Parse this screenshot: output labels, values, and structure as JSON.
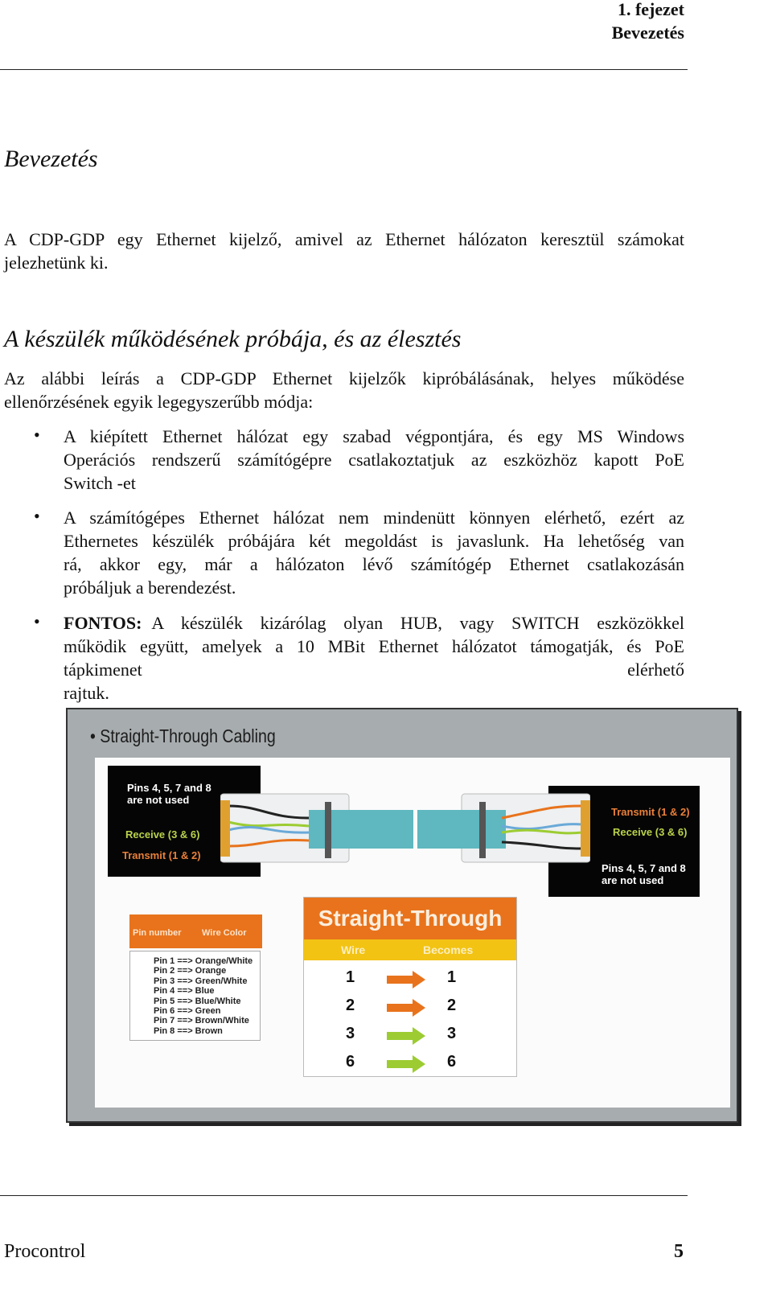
{
  "header": {
    "chapter": "1. fejezet",
    "title": "Bevezetés"
  },
  "section1": {
    "heading": "Bevezetés",
    "lines": [
      "A CDP-GDP egy Ethernet kijelző, amivel az Ethernet hálózaton keresztül számokat",
      "jelezhetünk ki."
    ]
  },
  "section2": {
    "heading": "A készülék működésének próbája, és az élesztés",
    "intro": [
      "Az alábbi leírás a CDP-GDP Ethernet kijelzők kipróbálásának, helyes működése",
      "ellenőrzésének egyik legegyszerűbb módja:"
    ],
    "bullets": [
      {
        "lines": [
          "A kiépített Ethernet hálózat egy szabad végpontjára, és egy MS Windows",
          "Operációs rendszerű számítógépre csatlakoztatjuk az eszközhöz kapott PoE",
          "Switch -et"
        ]
      },
      {
        "lines": [
          "A számítógépes Ethernet hálózat nem mindenütt könnyen elérhető, ezért az",
          "Ethernetes készülék próbájára két megoldást is javaslunk. Ha lehetőség van",
          "rá, akkor egy, már a hálózaton lévő számítógép Ethernet csatlakozásán",
          "próbáljuk a berendezést."
        ]
      },
      {
        "bold": "FONTOS:",
        "lines": [
          " A készülék kizárólag olyan HUB, vagy SWITCH eszközökkel",
          "működik együtt, amelyek a 10 MBit Ethernet hálózatot támogatják, és PoE",
          "tápkimenet elérhető",
          "rajtuk."
        ]
      }
    ]
  },
  "figure": {
    "title": "• Straight-Through Cabling",
    "left_box": {
      "note": [
        "Pins 4, 5, 7 and 8",
        "are not used"
      ],
      "receive": "Receive (3 & 6)",
      "transmit": "Transmit (1 & 2)"
    },
    "right_box": {
      "transmit": "Transmit (1 & 2)",
      "receive": "Receive (3 & 6)",
      "note": [
        "Pins 4, 5, 7 and 8",
        "are not used"
      ]
    },
    "pin_table": {
      "headers": [
        "Pin number",
        "Wire Color"
      ],
      "rows": [
        "Pin 1 ==> Orange/White",
        "Pin 2 ==> Orange",
        "Pin 3 ==> Green/White",
        "Pin 4 ==> Blue",
        "Pin 5 ==> Blue/White",
        "Pin 6 ==> Green",
        "Pin 7 ==> Brown/White",
        "Pin 8 ==> Brown"
      ]
    },
    "straight_table": {
      "title": "Straight-Through",
      "headers": [
        "Wire",
        "Becomes"
      ],
      "rows": [
        [
          "1",
          "1",
          "#e8731c"
        ],
        [
          "2",
          "2",
          "#e8731c"
        ],
        [
          "3",
          "3",
          "#9ccc32"
        ],
        [
          "6",
          "6",
          "#9ccc32"
        ]
      ]
    },
    "colors": {
      "orange": "#e8731c",
      "yellow": "#f2c313",
      "green": "#9ccc32",
      "cable": "#5fb7bf"
    }
  },
  "footer": {
    "company": "Procontrol",
    "page": "5"
  }
}
